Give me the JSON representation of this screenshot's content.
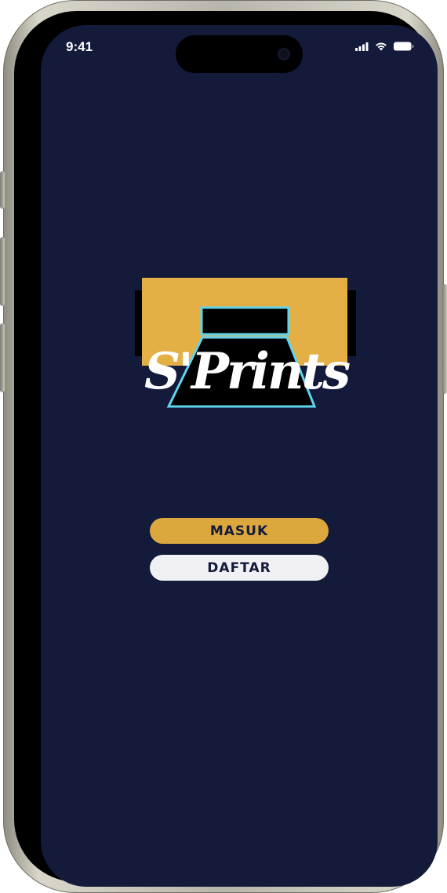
{
  "status_bar": {
    "time": "9:41",
    "icons": [
      "cellular-signal-icon",
      "wifi-icon",
      "battery-icon"
    ]
  },
  "logo": {
    "text": "S'Prints",
    "colors": {
      "banner": "#e4b045",
      "shadow": "#000000",
      "outline": "#5fd4ef"
    }
  },
  "actions": {
    "login_label": "MASUK",
    "register_label": "DAFTAR"
  },
  "colors": {
    "background": "#131a3a",
    "login_button": "#dca73d",
    "register_button": "#f1f1f5",
    "button_text": "#131a3a"
  }
}
